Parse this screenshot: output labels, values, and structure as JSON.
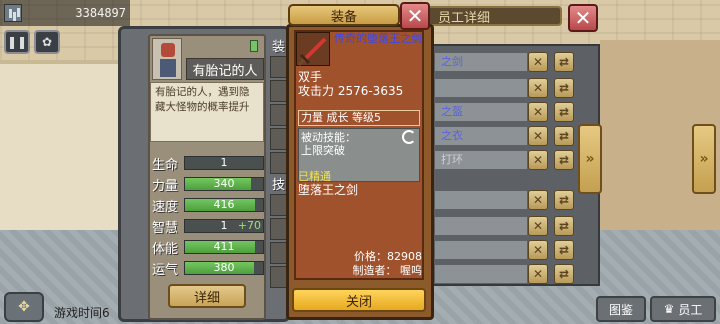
{
  "topbar": {
    "value": "3384897",
    "icon": "bar-chart-icon"
  },
  "employee": {
    "name": "有胎记的人",
    "description": "有胎记的人，遇到隐藏大怪物的概率提升",
    "stats": [
      {
        "label": "生命",
        "value": "1",
        "fill": 0.0,
        "bonus": ""
      },
      {
        "label": "力量",
        "value": "340",
        "fill": 0.85,
        "bonus": ""
      },
      {
        "label": "速度",
        "value": "416",
        "fill": 0.9,
        "bonus": ""
      },
      {
        "label": "智慧",
        "value": "1",
        "fill": 0.0,
        "bonus": "+70"
      },
      {
        "label": "体能",
        "value": "411",
        "fill": 0.9,
        "bonus": ""
      },
      {
        "label": "运气",
        "value": "380",
        "fill": 0.88,
        "bonus": ""
      }
    ],
    "detail_button": "详细",
    "side_label_top": "装",
    "side_label_mid": "技"
  },
  "back_panel": {
    "title": "员工详细",
    "rows": [
      "之剑",
      "",
      "之盔",
      "之衣",
      "打环",
      "",
      "",
      "",
      ""
    ]
  },
  "popup": {
    "tab_title": "装备",
    "item_name": "传奇的堕落王之剑",
    "item_type": "双手",
    "attack": "攻击力 2576-3635",
    "requirements": "力量 成长 等级5",
    "passive_label": "被动技能：",
    "passive_skill": "上限突破",
    "mastered_label": "已精通",
    "mastered_name": "堕落王之剑",
    "price": "价格：82908",
    "maker": "制造者：   喔呜",
    "close_button": "关闭"
  },
  "bottom": {
    "game_time": "游戏时间6",
    "atlas_button": "图鉴",
    "staff_button": "员工"
  },
  "colors": {
    "popup_bg": "#a0522d",
    "item_name": "#3b47e8",
    "mastered": "#f3e04a",
    "close_button": "#ffd35c"
  }
}
